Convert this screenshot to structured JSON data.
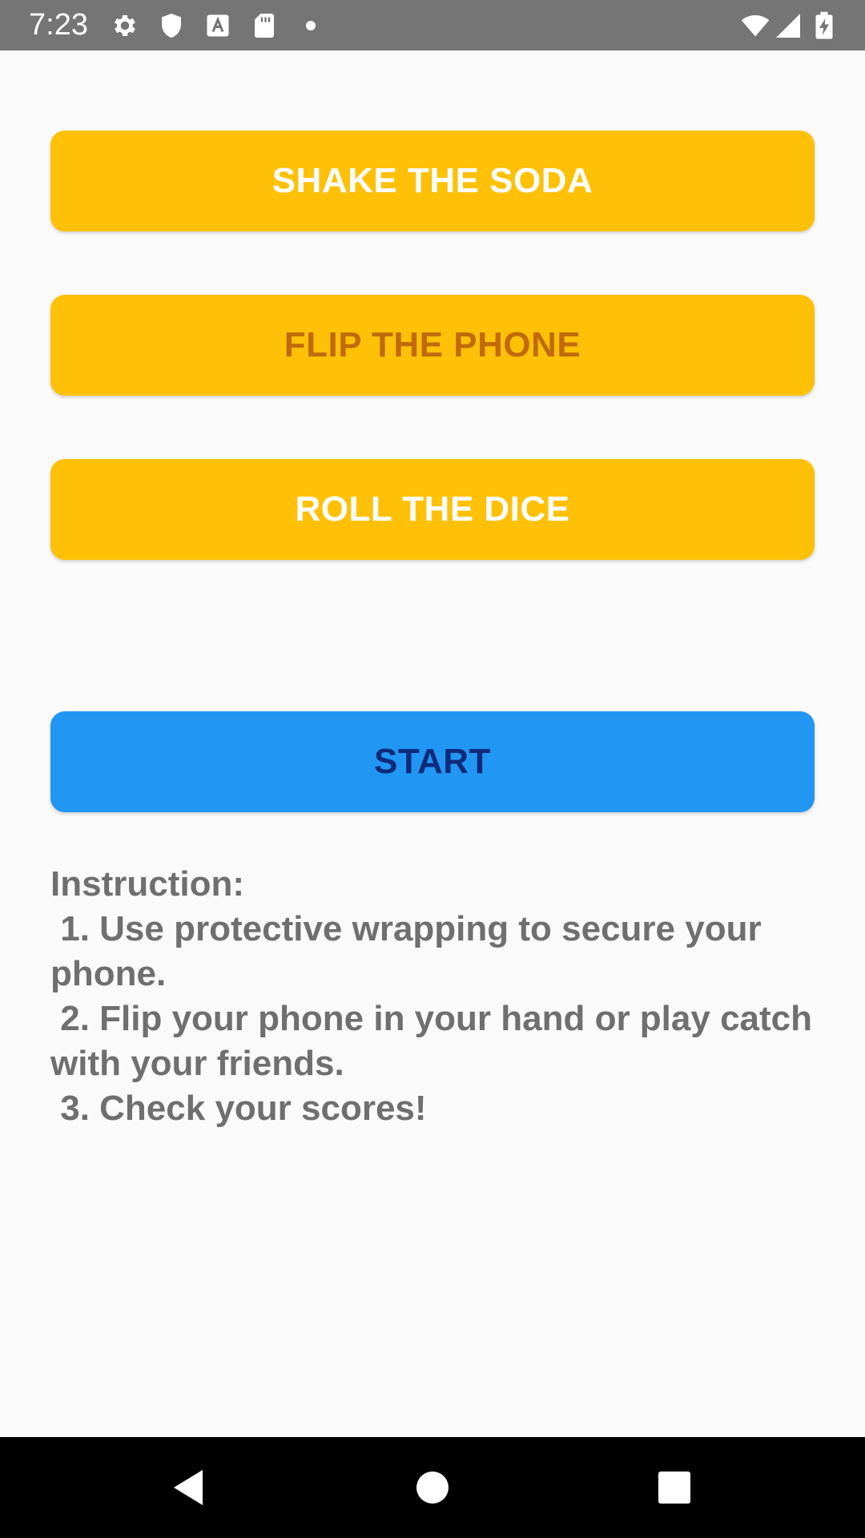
{
  "status_bar": {
    "time": "7:23",
    "icons": [
      "gear-icon",
      "shield-icon",
      "text-a-icon",
      "sd-card-icon",
      "dot-icon",
      "wifi-icon",
      "signal-icon",
      "battery-charging-icon"
    ]
  },
  "modes": {
    "shake_label": "SHAKE THE SODA",
    "flip_label": "FLIP THE PHONE",
    "dice_label": "ROLL THE DICE",
    "selected": "FLIP THE PHONE"
  },
  "start": {
    "label": "START"
  },
  "instructions": {
    "heading": "Instruction:",
    "step1": " 1. Use protective wrapping to secure your phone.",
    "step2": " 2. Flip your phone in your hand or play catch with your friends.",
    "step3": " 3. Check your scores!"
  },
  "colors": {
    "mode_button": "#ffc107",
    "mode_selected_text": "#c06a0a",
    "start_button": "#2196f3",
    "start_text": "#0d2a7a",
    "status_bar": "#757575"
  },
  "nav": {
    "icons": [
      "back-icon",
      "home-icon",
      "recents-icon"
    ]
  }
}
